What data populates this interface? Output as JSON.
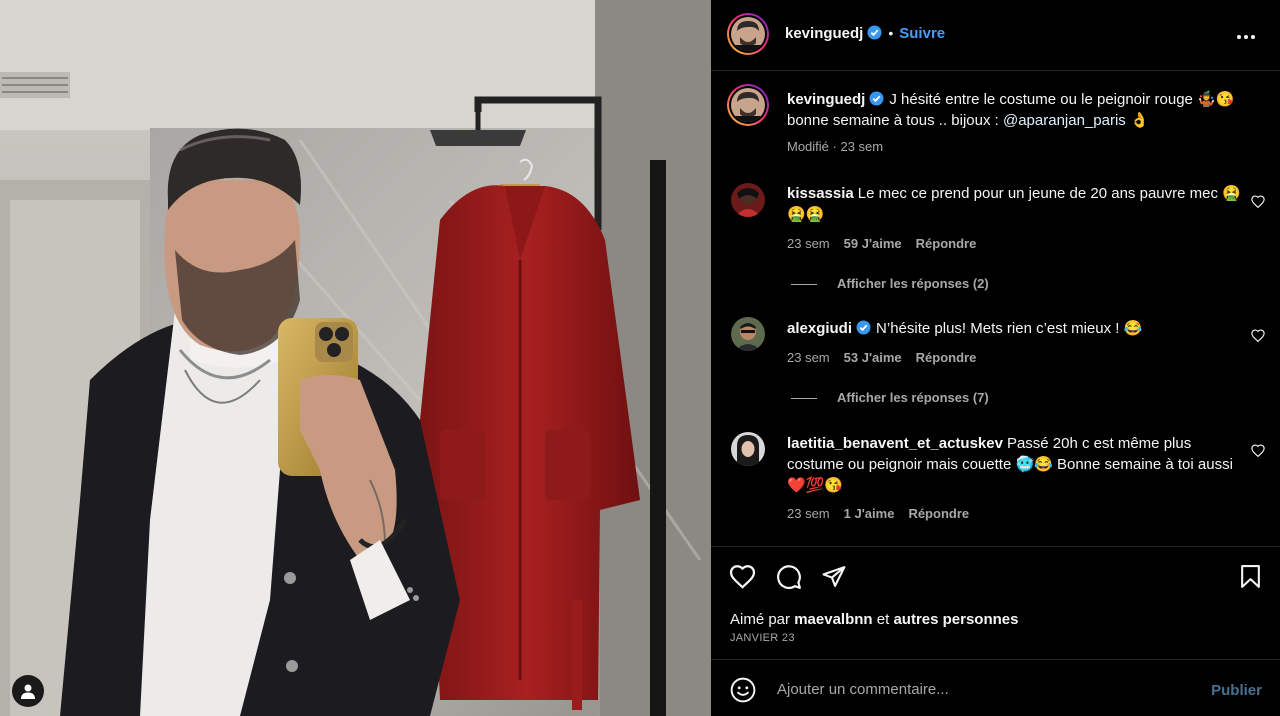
{
  "post": {
    "author": "kevinguedj",
    "follow_label": "Suivre",
    "dot": "•",
    "caption": "J hésité entre le costume ou le peignoir rouge 🤹😘 bonne semaine à tous .. bijoux : ",
    "caption_mention": "@aparanjan_paris",
    "caption_end": " 👌",
    "caption_meta": "Modifié · 23 sem"
  },
  "comments": [
    {
      "user": "kissassia",
      "text": "Le mec ce prend pour un jeune de 20 ans pauvre mec 🤮🤮🤮",
      "time": "23 sem",
      "likes": "59 J'aime",
      "reply": "Répondre",
      "view_replies": "Afficher les réponses (2)"
    },
    {
      "user": "alexgiudi",
      "text": "N’hésite plus! Mets rien c’est mieux ! 😂",
      "time": "23 sem",
      "likes": "53 J'aime",
      "reply": "Répondre",
      "view_replies": "Afficher les réponses (7)"
    },
    {
      "user": "laetitia_benavent_et_actuskev",
      "text": "Passé 20h c est même plus costume ou peignoir mais couette 🥶😂 Bonne semaine à toi aussi ❤️💯😘",
      "time": "23 sem",
      "likes": "1 J'aime",
      "reply": "Répondre"
    }
  ],
  "likes_line": {
    "prefix": "Aimé par ",
    "user": "maevalbnn",
    "middle": " et ",
    "others": "autres personnes"
  },
  "date": "JANVIER 23",
  "composer": {
    "placeholder": "Ajouter un commentaire...",
    "publish": "Publier"
  },
  "icons": [
    "user-tag-icon",
    "verified-icon",
    "more-icon",
    "heart-icon",
    "comment-icon",
    "share-icon",
    "bookmark-icon",
    "emoji-icon"
  ],
  "colors": {
    "accent": "#4a9df6",
    "verified": "#3897f0",
    "background": "#000000",
    "publish_disabled": "#4a6f93"
  }
}
